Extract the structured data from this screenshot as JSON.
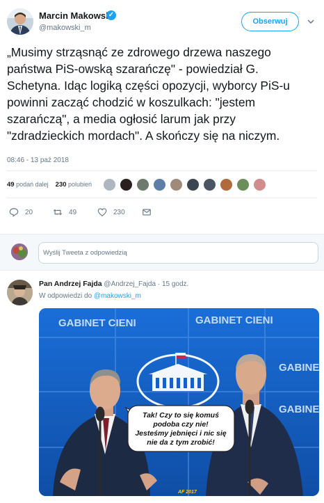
{
  "tweet": {
    "author": {
      "name": "Marcin Makowski",
      "handle": "@makowski_m",
      "verified_icon": "verified-badge-icon"
    },
    "follow_label": "Obserwuj",
    "text": "„Musimy strząsnąć ze zdrowego drzewa naszego\npaństwa PiS-owską szarańczę\" - powiedział G.\nSchetyna. Idąc logiką części opozycji, wyborcy PiS-u\npowinni zacząć chodzić w koszulkach: \"jestem\nszarańczą\", a media ogłosić larum jak przy\n\"zdradzieckich mordach\". A skończy się na niczym.",
    "timestamp": "08:46 - 13 paź 2018",
    "stats": {
      "retweets_count": "49",
      "retweets_label": "podań dalej",
      "likes_count": "230",
      "likes_label": "polubień"
    },
    "actions": {
      "reply_count": "20",
      "retweet_count": "49",
      "like_count": "230"
    }
  },
  "reply_box": {
    "placeholder": "Wyślij Tweeta z odpowiedzią"
  },
  "reply": {
    "author_name": "Pan Andrzej Fajda",
    "author_handle": "@Andrzej_Fajda",
    "separator": "·",
    "time": "15 godz.",
    "context_prefix": "W odpowiedzi do",
    "context_mention": "@makowski_m",
    "image": {
      "banner_text": "GABINET CIENI",
      "bubble_line1": "Tak! Czy to się komuś",
      "bubble_line2": "podoba czy nie!",
      "bubble_line3": "Jesteśmy jebnięci i nic się",
      "bubble_line4": "nie da z tym zrobić!",
      "signature": "AF 2017"
    }
  },
  "colors": {
    "accent": "#1da1f2",
    "muted": "#657786",
    "text": "#14171a",
    "divider": "#e6ecf0"
  }
}
